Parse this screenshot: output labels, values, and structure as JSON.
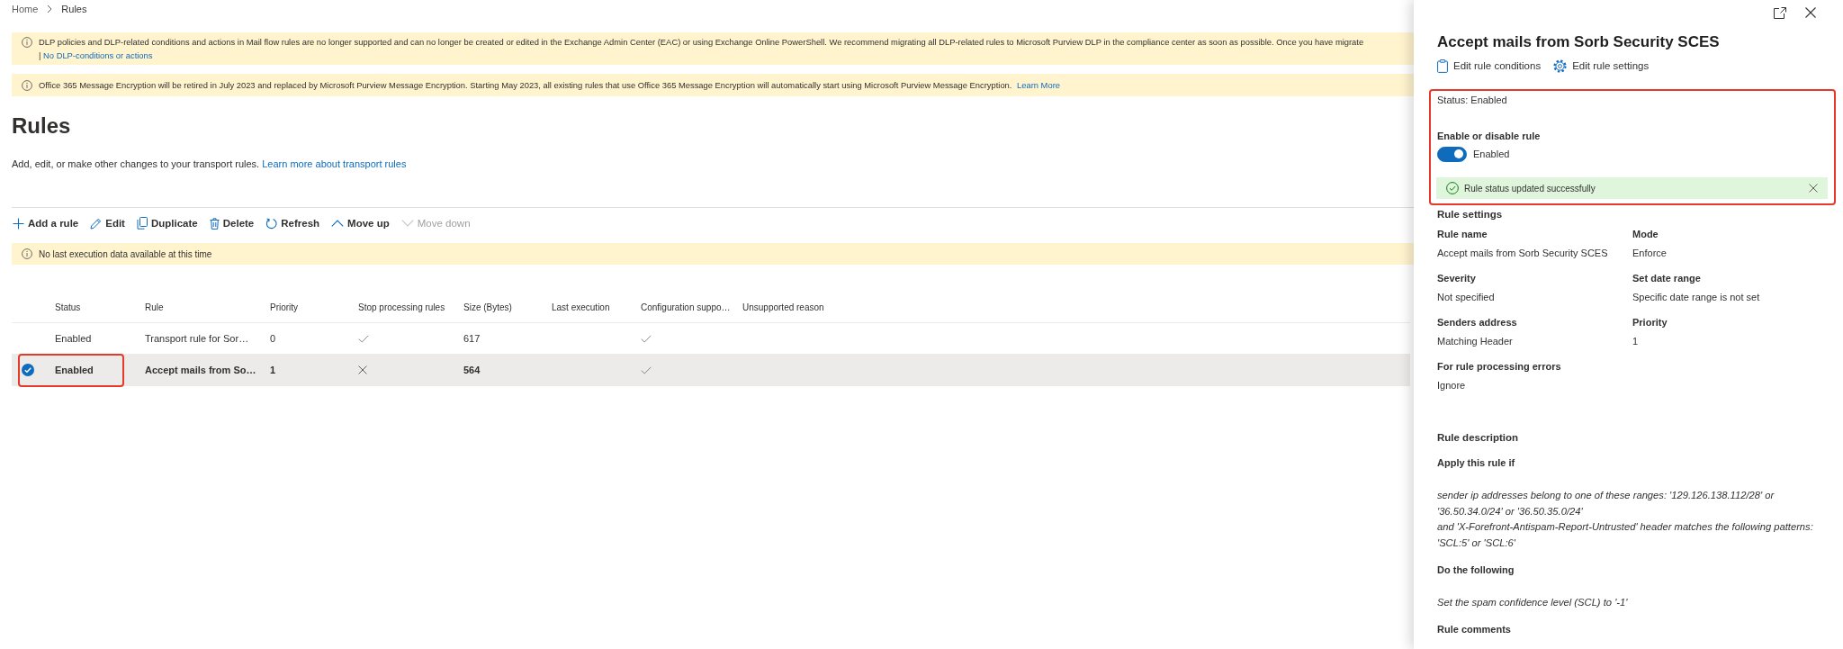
{
  "breadcrumb": [
    {
      "label": "Home",
      "selected": false
    },
    {
      "label": "Rules",
      "selected": true
    }
  ],
  "banners": [
    {
      "text": "DLP policies and DLP-related conditions and actions in Mail flow rules are no longer supported and can no longer be created or edited in the Exchange Admin Center (EAC) or using Exchange Online PowerShell. We recommend migrating all DLP-related rules to Microsoft Purview DLP in the compliance center as soon as possible. Once you have migrate",
      "separator": "|",
      "link": "No DLP-conditions or actions"
    },
    {
      "text": "Office 365 Message Encryption will be retired in July 2023 and replaced by Microsoft Purview Message Encryption. Starting May 2023, all existing rules that use Office 365 Message Encryption will automatically start using Microsoft Purview Message Encryption.",
      "link": "Learn More"
    }
  ],
  "page": {
    "title": "Rules",
    "description": "Add, edit, or make other changes to your transport rules.",
    "description_link": "Learn more about transport rules"
  },
  "toolbar": [
    {
      "kind": "add",
      "label": "Add a rule",
      "disabled": false
    },
    {
      "kind": "edit",
      "label": "Edit",
      "disabled": false
    },
    {
      "kind": "duplicate",
      "label": "Duplicate",
      "disabled": false
    },
    {
      "kind": "delete",
      "label": "Delete",
      "disabled": false
    },
    {
      "kind": "refresh",
      "label": "Refresh",
      "disabled": false
    },
    {
      "kind": "move-up",
      "label": "Move up",
      "disabled": false
    },
    {
      "kind": "move-down",
      "label": "Move down",
      "disabled": true
    }
  ],
  "notice": {
    "text": "No last execution data available at this time"
  },
  "table": {
    "columns": [
      "Status",
      "Rule",
      "Priority",
      "Stop processing rules",
      "Size (Bytes)",
      "Last execution",
      "Configuration suppo…",
      "Unsupported reason"
    ],
    "rows": [
      {
        "selected": false,
        "framed": false,
        "status": "Enabled",
        "rule": "Transport rule for Sor…",
        "priority": "0",
        "stop_processing": true,
        "size": "617",
        "config_supported": true
      },
      {
        "selected": true,
        "framed": true,
        "status": "Enabled",
        "rule": "Accept mails from So…",
        "priority": "1",
        "stop_processing": false,
        "size": "564",
        "config_supported": true
      }
    ]
  },
  "panel": {
    "title": "Accept mails from Sorb Security SCES",
    "actions": [
      {
        "kind": "conditions",
        "label": "Edit rule conditions"
      },
      {
        "kind": "settings",
        "label": "Edit rule settings"
      }
    ],
    "status_section": {
      "framed": true,
      "status": "Status: Enabled",
      "toggle_heading": "Enable or disable rule",
      "toggle": {
        "on": true,
        "label": "Enabled"
      },
      "message": "Rule status updated successfully"
    },
    "settings_heading": "Rule settings",
    "settings": [
      {
        "label": "Rule name",
        "value": "Accept mails from Sorb Security SCES"
      },
      {
        "label": "Mode",
        "value": "Enforce"
      },
      {
        "label": "Severity",
        "value": "Not specified"
      },
      {
        "label": "Set date range",
        "value": "Specific date range is not set"
      },
      {
        "label": "Senders address",
        "value": "Matching Header"
      },
      {
        "label": "Priority",
        "value": "1"
      },
      {
        "label": "For rule processing errors",
        "value": "Ignore"
      }
    ],
    "description_heading": "Rule description",
    "description": [
      {
        "heading": "Apply this rule if",
        "lines": [
          "sender ip addresses belong to one of these ranges: '129.126.138.112/28' or '36.50.34.0/24' or '36.50.35.0/24'",
          "and 'X-Forefront-Antispam-Report-Untrusted' header matches the following patterns: 'SCL:5' or 'SCL:6'"
        ]
      },
      {
        "heading": "Do the following",
        "lines": [
          "Set the spam confidence level (SCL) to '-1'"
        ]
      },
      {
        "heading": "Rule comments"
      }
    ]
  }
}
